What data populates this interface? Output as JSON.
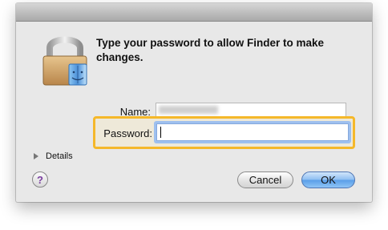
{
  "dialog": {
    "message": "Type your password to allow Finder to make changes.",
    "name_label": "Name:",
    "name_value": "",
    "password_label": "Password:",
    "password_value": "",
    "details_label": "Details",
    "help_label": "?",
    "cancel_label": "Cancel",
    "ok_label": "OK"
  },
  "colors": {
    "highlight": "#f5b82a",
    "default_button": "#5a9ee8",
    "focus_ring": "#9ec0ef"
  }
}
